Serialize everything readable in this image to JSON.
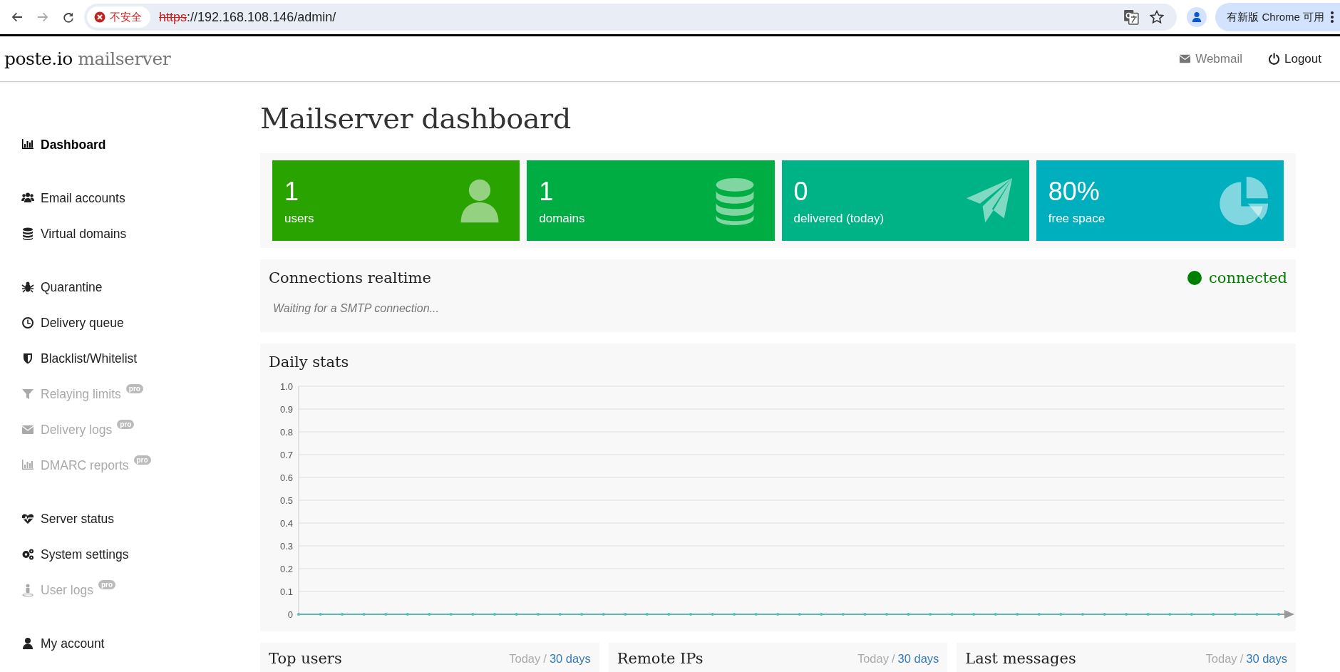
{
  "browser": {
    "security_label": "不安全",
    "url_scheme": "https",
    "url_rest": "://192.168.108.146/admin/",
    "update_label": "有新版 Chrome 可用"
  },
  "header": {
    "brand": "poste.io",
    "brand_suffix": "mailserver",
    "links": [
      {
        "label": "Webmail",
        "kind": "envelope",
        "muted": true
      },
      {
        "label": "Logout",
        "kind": "power",
        "muted": false
      }
    ]
  },
  "sidebar": {
    "groups": [
      {
        "items": [
          {
            "label": "Dashboard",
            "kind": "chart",
            "selected": true,
            "disabled": false
          }
        ]
      },
      {
        "items": [
          {
            "label": "Email accounts",
            "kind": "users",
            "selected": false,
            "disabled": false
          },
          {
            "label": "Virtual domains",
            "kind": "database",
            "selected": false,
            "disabled": false
          }
        ]
      },
      {
        "items": [
          {
            "label": "Quarantine",
            "kind": "bug",
            "selected": false,
            "disabled": false
          },
          {
            "label": "Delivery queue",
            "kind": "clock",
            "selected": false,
            "disabled": false
          },
          {
            "label": "Blacklist/Whitelist",
            "kind": "shield",
            "selected": false,
            "disabled": false
          },
          {
            "label": "Relaying limits",
            "kind": "filter",
            "selected": false,
            "disabled": true,
            "badge": "pro"
          },
          {
            "label": "Delivery logs",
            "kind": "envelope",
            "selected": false,
            "disabled": true,
            "badge": "pro"
          },
          {
            "label": "DMARC reports",
            "kind": "chart",
            "selected": false,
            "disabled": true,
            "badge": "pro"
          }
        ]
      },
      {
        "items": [
          {
            "label": "Server status",
            "kind": "heartbeat",
            "selected": false,
            "disabled": false
          },
          {
            "label": "System settings",
            "kind": "gears",
            "selected": false,
            "disabled": false
          },
          {
            "label": "User logs",
            "kind": "pin",
            "selected": false,
            "disabled": true,
            "badge": "pro"
          }
        ]
      },
      {
        "items": [
          {
            "label": "My account",
            "kind": "user",
            "selected": false,
            "disabled": false
          }
        ]
      }
    ]
  },
  "page_title": "Mailserver dashboard",
  "cards": [
    {
      "value": "1",
      "label": "users",
      "kind": "user",
      "color": "#28a300"
    },
    {
      "value": "1",
      "label": "domains",
      "kind": "database",
      "color": "#00ad43"
    },
    {
      "value": "0",
      "label": "delivered (today)",
      "kind": "plane",
      "color": "#00b386"
    },
    {
      "value": "80%",
      "label": "free space",
      "kind": "pie",
      "color": "#00afbe"
    }
  ],
  "connections": {
    "title": "Connections realtime",
    "status": "connected",
    "connected": true,
    "message": "Waiting for a SMTP connection..."
  },
  "daily_stats": {
    "title": "Daily stats",
    "chart_data": {
      "type": "line",
      "grid": true,
      "ylim": [
        0,
        1
      ],
      "yticks": [
        {
          "value": 0,
          "label": "0"
        },
        0.1,
        0.2,
        0.3,
        0.4,
        0.5,
        0.6,
        0.7,
        0.8,
        0.9,
        {
          "value": 1,
          "label": "1.0"
        }
      ],
      "series": [
        {
          "color": "#4fc1b6",
          "values": [
            0,
            0,
            0,
            0,
            0,
            0,
            0,
            0,
            0,
            0,
            0,
            0,
            0,
            0,
            0,
            0,
            0,
            0,
            0,
            0,
            0,
            0,
            0,
            0,
            0,
            0,
            0,
            0,
            0,
            0,
            0,
            0,
            0,
            0,
            0,
            0,
            0,
            0,
            0,
            0,
            0,
            0,
            0,
            0,
            0,
            0
          ]
        }
      ]
    }
  },
  "panels": [
    {
      "title": "Top users",
      "periods": [
        {
          "label": "Today",
          "selected": true
        },
        {
          "label": "30 days",
          "selected": false
        }
      ],
      "separator": "/"
    },
    {
      "title": "Remote IPs",
      "periods": [
        {
          "label": "Today",
          "selected": true
        },
        {
          "label": "30 days",
          "selected": false
        }
      ],
      "separator": "/"
    },
    {
      "title": "Last messages",
      "periods": [
        {
          "label": "Today",
          "selected": true
        },
        {
          "label": "30 days",
          "selected": false
        }
      ],
      "separator": "/"
    }
  ]
}
